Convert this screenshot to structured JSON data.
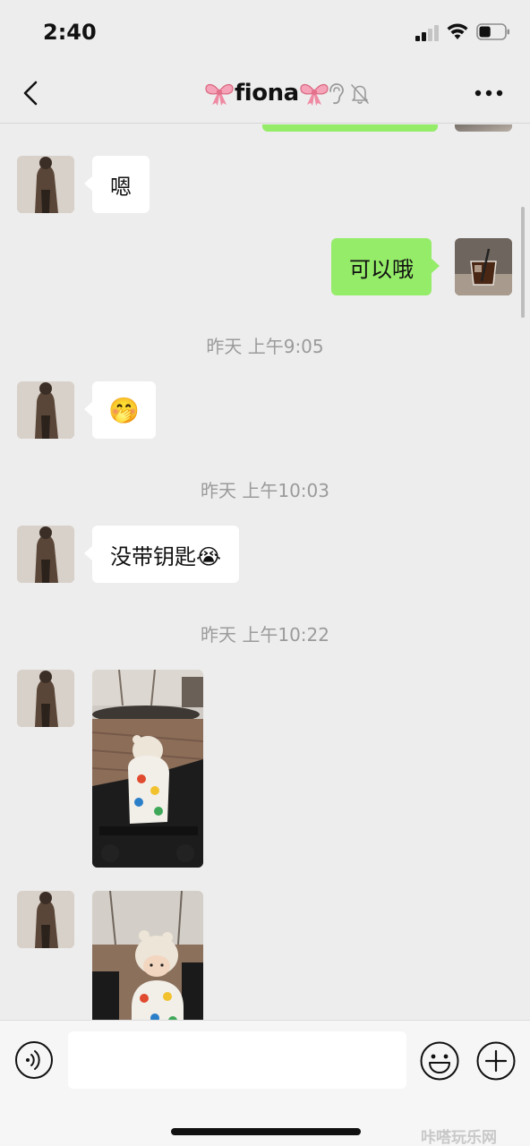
{
  "status_bar": {
    "time": "2:40",
    "signal_bars": 2,
    "battery_level": 0.45
  },
  "nav": {
    "title": "fiona",
    "title_prefix_emoji": "ribbon",
    "title_suffix_emoji": "ribbon",
    "ear_icon": "ear-icon",
    "mute_icon": "bell-slash-icon"
  },
  "messages": [
    {
      "type": "text",
      "direction": "in",
      "text": "嗯"
    },
    {
      "type": "text",
      "direction": "out",
      "text": "可以哦"
    },
    {
      "type": "time",
      "text": "昨天 上午9:05"
    },
    {
      "type": "text",
      "direction": "in",
      "text": "🤭"
    },
    {
      "type": "time",
      "text": "昨天 上午10:03"
    },
    {
      "type": "text",
      "direction": "in",
      "text": "没带钥匙😭"
    },
    {
      "type": "time",
      "text": "昨天 上午10:22"
    },
    {
      "type": "image",
      "direction": "in",
      "subject": "baby in white bear hat seated in stroller outdoors"
    },
    {
      "type": "image",
      "direction": "in",
      "subject": "baby in bear hat facing camera in stroller"
    }
  ],
  "input": {
    "placeholder": ""
  },
  "colors": {
    "background": "#ededed",
    "bubble_out": "#95ec69",
    "bubble_in": "#ffffff",
    "timestamp": "#9b9b9b"
  },
  "watermark": "咔嗒玩乐网"
}
